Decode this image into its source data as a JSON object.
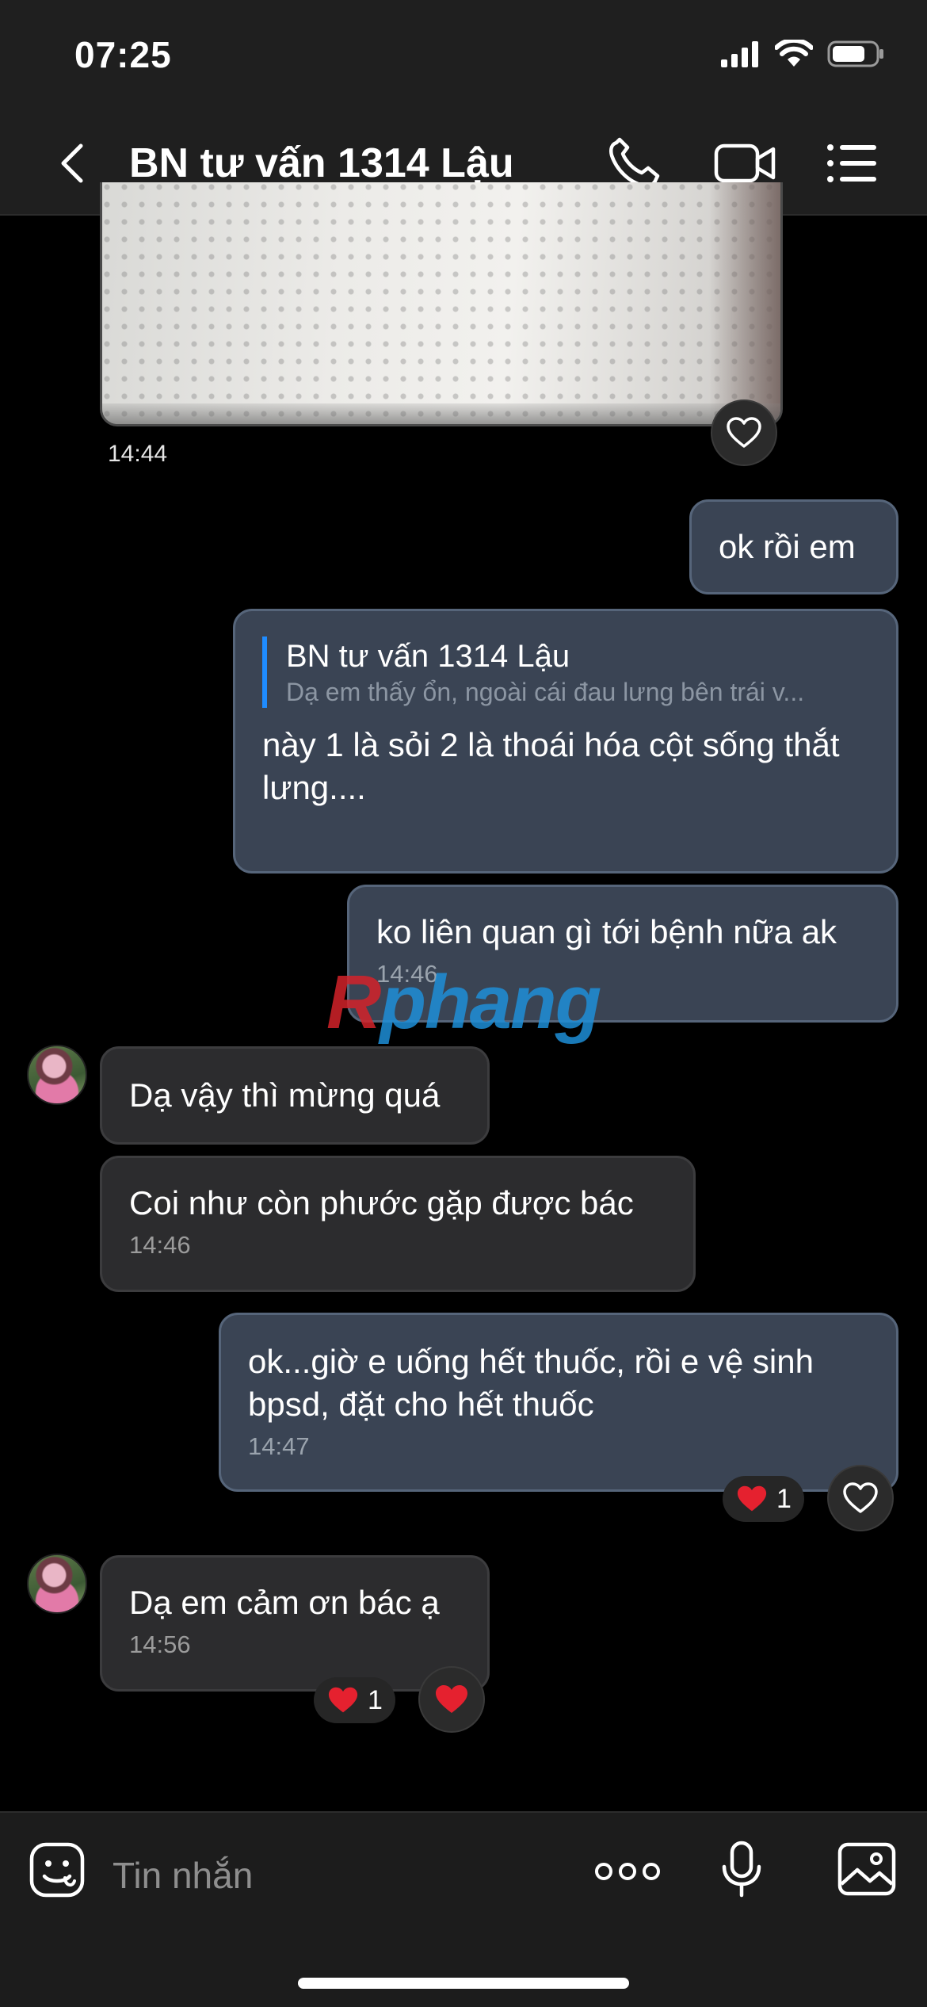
{
  "status_bar": {
    "time": "07:25"
  },
  "header": {
    "title": "BN tư vấn 1314 Lậu"
  },
  "image_message": {
    "time": "14:44"
  },
  "messages": [
    {
      "text": "ok rồi em"
    },
    {
      "quote_name": "BN tư vấn 1314 Lậu",
      "quote_text": "Dạ em thấy ổn, ngoài cái đau lưng bên trái v...",
      "text": "này 1 là sỏi 2 là thoái hóa cột sống thắt lưng...."
    },
    {
      "text": "ko liên quan gì tới bệnh nữa ak",
      "time": "14:46"
    },
    {
      "text": "Dạ vậy thì mừng quá"
    },
    {
      "text": "Coi như còn phước gặp được bác",
      "time": "14:46"
    },
    {
      "text": "ok...giờ e uống hết thuốc, rồi e vệ sinh bpsd, đặt cho hết thuốc",
      "time": "14:47",
      "reaction_count": "1"
    },
    {
      "text": "Dạ em cảm ơn bác ạ",
      "time": "14:56",
      "reaction_count": "1"
    }
  ],
  "watermark": {
    "first": "R",
    "rest": "phang"
  },
  "composer": {
    "placeholder": "Tin nhắn"
  },
  "colors": {
    "outgoing_bubble": "#3a4454",
    "incoming_bubble": "#2c2c2e",
    "accent": "#1f8cff",
    "heart": "#e5212f"
  }
}
